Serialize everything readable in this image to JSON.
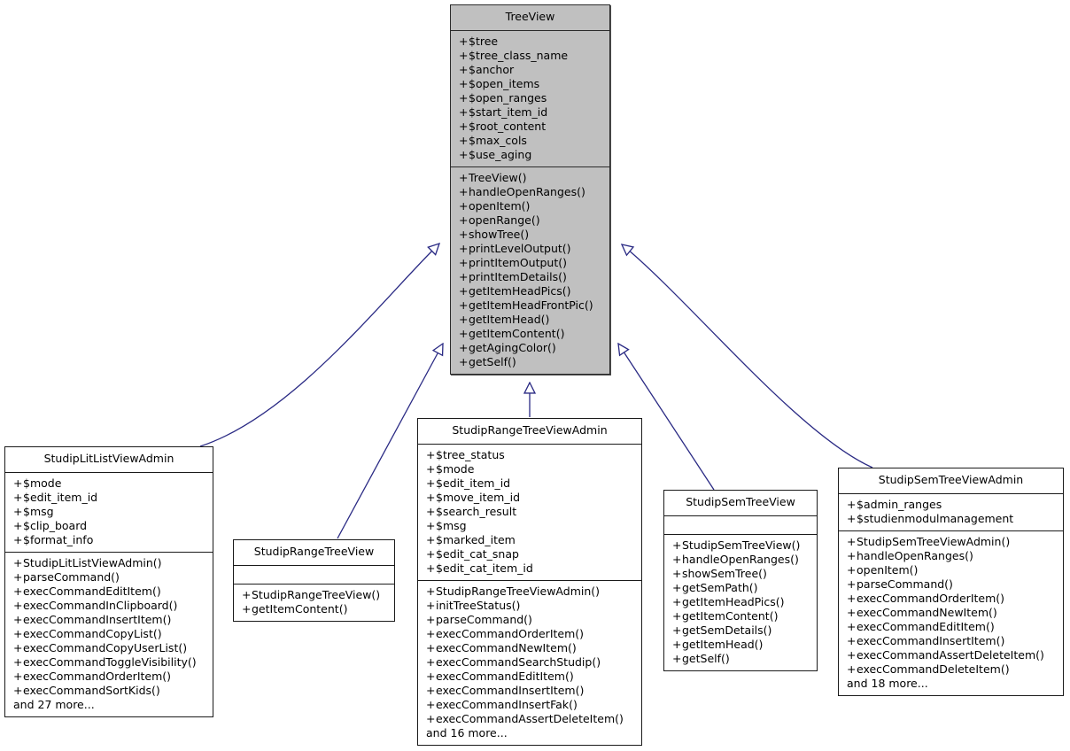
{
  "diagram": {
    "type": "uml-class-inheritance",
    "relationship": "generalization",
    "arrow_color": "#2a2a84",
    "base_class_fill": "#c0c0c0",
    "derived_class_fill": "#ffffff",
    "border_color": "#1a1a1a",
    "background": "#ffffff"
  },
  "classes": [
    {
      "id": "treeview",
      "name": "TreeView",
      "attributes": [
        "+ $tree",
        "+ $tree_class_name",
        "+ $anchor",
        "+ $open_items",
        "+ $open_ranges",
        "+ $start_item_id",
        "+ $root_content",
        "+ $max_cols",
        "+ $use_aging"
      ],
      "methods": [
        "+ TreeView()",
        "+ handleOpenRanges()",
        "+ openItem()",
        "+ openRange()",
        "+ showTree()",
        "+ printLevelOutput()",
        "+ printItemOutput()",
        "+ printItemDetails()",
        "+ getItemHeadPics()",
        "+ getItemHeadFrontPic()",
        "+ getItemHead()",
        "+ getItemContent()",
        "+ getAgingColor()",
        "+ getSelf()"
      ],
      "more": null
    },
    {
      "id": "litlistviewadmin",
      "name": "StudipLitListViewAdmin",
      "attributes": [
        "+ $mode",
        "+ $edit_item_id",
        "+ $msg",
        "+ $clip_board",
        "+ $format_info"
      ],
      "methods": [
        "+ StudipLitListViewAdmin()",
        "+ parseCommand()",
        "+ execCommandEditItem()",
        "+ execCommandInClipboard()",
        "+ execCommandInsertItem()",
        "+ execCommandCopyList()",
        "+ execCommandCopyUserList()",
        "+ execCommandToggleVisibility()",
        "+ execCommandOrderItem()",
        "+ execCommandSortKids()"
      ],
      "more": "and 27 more..."
    },
    {
      "id": "rangetreeview",
      "name": "StudipRangeTreeView",
      "attributes": [],
      "methods": [
        "+ StudipRangeTreeView()",
        "+ getItemContent()"
      ],
      "more": null
    },
    {
      "id": "rangetreeviewadmin",
      "name": "StudipRangeTreeViewAdmin",
      "attributes": [
        "+ $tree_status",
        "+ $mode",
        "+ $edit_item_id",
        "+ $move_item_id",
        "+ $search_result",
        "+ $msg",
        "+ $marked_item",
        "+ $edit_cat_snap",
        "+ $edit_cat_item_id"
      ],
      "methods": [
        "+ StudipRangeTreeViewAdmin()",
        "+ initTreeStatus()",
        "+ parseCommand()",
        "+ execCommandOrderItem()",
        "+ execCommandNewItem()",
        "+ execCommandSearchStudip()",
        "+ execCommandEditItem()",
        "+ execCommandInsertItem()",
        "+ execCommandInsertFak()",
        "+ execCommandAssertDeleteItem()"
      ],
      "more": "and 16 more..."
    },
    {
      "id": "semtreeview",
      "name": "StudipSemTreeView",
      "attributes": [],
      "methods": [
        "+ StudipSemTreeView()",
        "+ handleOpenRanges()",
        "+ showSemTree()",
        "+ getSemPath()",
        "+ getItemHeadPics()",
        "+ getItemContent()",
        "+ getSemDetails()",
        "+ getItemHead()",
        "+ getSelf()"
      ],
      "more": null
    },
    {
      "id": "semtreeviewadmin",
      "name": "StudipSemTreeViewAdmin",
      "attributes": [
        "+ $admin_ranges",
        "+ $studienmodulmanagement"
      ],
      "methods": [
        "+ StudipSemTreeViewAdmin()",
        "+ handleOpenRanges()",
        "+ openItem()",
        "+ parseCommand()",
        "+ execCommandOrderItem()",
        "+ execCommandNewItem()",
        "+ execCommandEditItem()",
        "+ execCommandInsertItem()",
        "+ execCommandAssertDeleteItem()",
        "+ execCommandDeleteItem()"
      ],
      "more": "and 18 more..."
    }
  ],
  "edges": [
    {
      "from": "litlistviewadmin",
      "to": "treeview"
    },
    {
      "from": "rangetreeview",
      "to": "treeview"
    },
    {
      "from": "rangetreeviewadmin",
      "to": "treeview"
    },
    {
      "from": "semtreeview",
      "to": "treeview"
    },
    {
      "from": "semtreeviewadmin",
      "to": "treeview"
    }
  ]
}
